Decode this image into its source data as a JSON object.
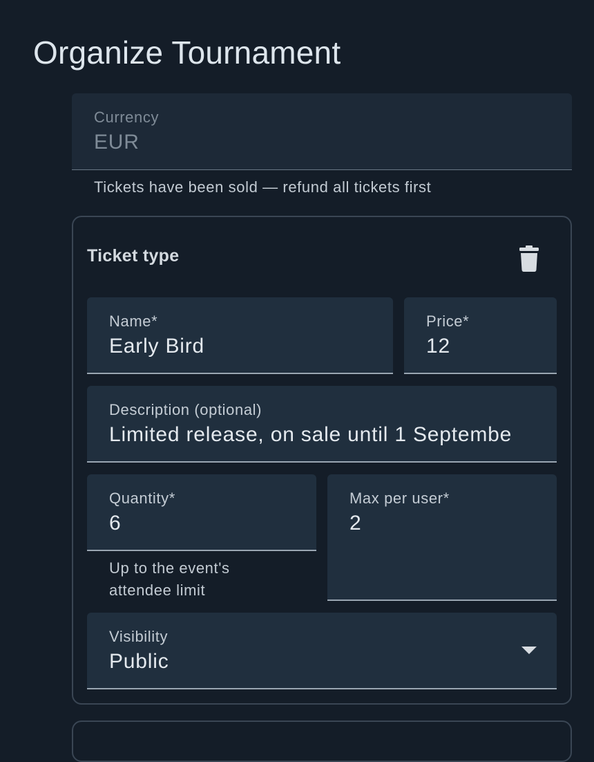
{
  "page": {
    "title": "Organize Tournament"
  },
  "currency": {
    "label": "Currency",
    "value": "EUR",
    "helper": "Tickets have been sold — refund all tickets first"
  },
  "ticket_type": {
    "title": "Ticket type",
    "delete_icon": "trash-icon",
    "name": {
      "label": "Name*",
      "value": "Early Bird"
    },
    "price": {
      "label": "Price*",
      "value": "12"
    },
    "description": {
      "label": "Description (optional)",
      "value": "Limited release, on sale until 1 Septembe"
    },
    "quantity": {
      "label": "Quantity*",
      "value": "6",
      "helper_line1": "Up to the event's",
      "helper_line2": "attendee limit"
    },
    "max_per_user": {
      "label": "Max per user*",
      "value": "2"
    },
    "visibility": {
      "label": "Visibility",
      "value": "Public",
      "icon": "caret-down-icon"
    }
  },
  "colors": {
    "background": "#141d28",
    "field_background": "#202f3e",
    "card_border": "#3a4654",
    "text": "#dfe5eb"
  }
}
